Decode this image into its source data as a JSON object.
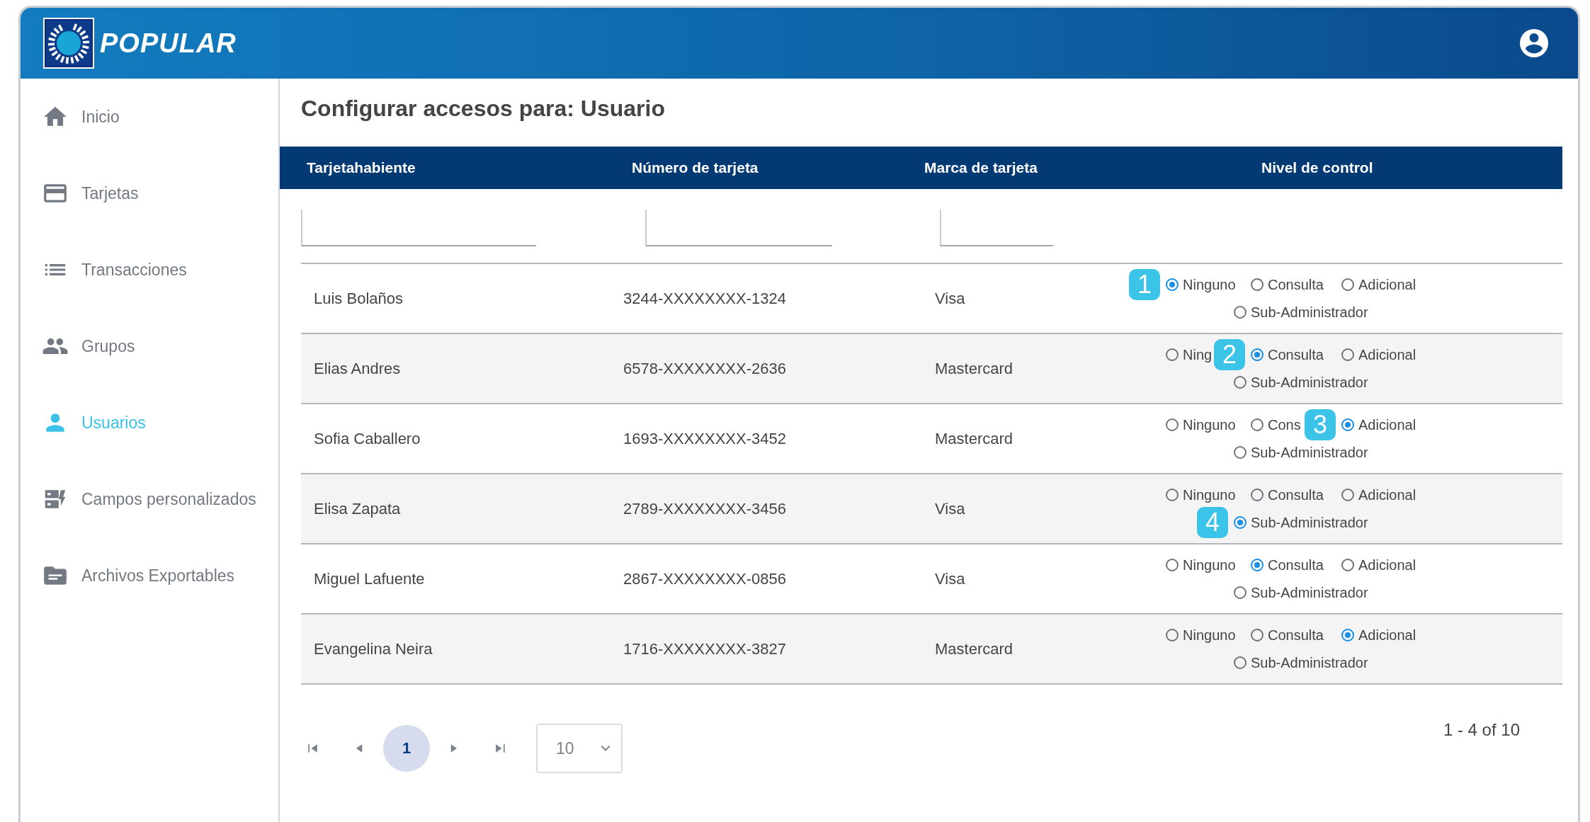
{
  "header": {
    "brand": "POPULAR"
  },
  "sidebar": {
    "items": [
      {
        "label": "Inicio",
        "selected": false
      },
      {
        "label": "Tarjetas",
        "selected": false
      },
      {
        "label": "Transacciones",
        "selected": false
      },
      {
        "label": "Grupos",
        "selected": false
      },
      {
        "label": "Usuarios",
        "selected": true
      },
      {
        "label": "Campos personalizados",
        "selected": false
      },
      {
        "label": "Archivos Exportables",
        "selected": false
      }
    ]
  },
  "page": {
    "title": "Configurar accesos para: Usuario"
  },
  "table": {
    "columns": [
      {
        "label": "Tarjetahabiente",
        "filter": true
      },
      {
        "label": "Número de tarjeta",
        "filter": true
      },
      {
        "label": "Marca de tarjeta",
        "filter": true
      },
      {
        "label": "Nivel de control",
        "filter": false
      }
    ],
    "rows": [
      {
        "cardholder": "Luis Bolaños",
        "card_number": "3244-XXXXXXXX-1324",
        "brand": "Visa",
        "options": [
          {
            "label": "Ninguno",
            "selected": true,
            "badge": "1"
          },
          {
            "label": "Consulta",
            "selected": false
          },
          {
            "label": "Adicional",
            "selected": false
          },
          {
            "label": "Sub-Administrador",
            "selected": false
          }
        ]
      },
      {
        "cardholder": "Elias Andres",
        "card_number": "6578-XXXXXXXX-2636",
        "brand": "Mastercard",
        "options": [
          {
            "label": "Ning",
            "selected": false
          },
          {
            "label": "Consulta",
            "selected": true,
            "badge": "2"
          },
          {
            "label": "Adicional",
            "selected": false
          },
          {
            "label": "Sub-Administrador",
            "selected": false
          }
        ]
      },
      {
        "cardholder": "Sofia Caballero",
        "card_number": "1693-XXXXXXXX-3452",
        "brand": "Mastercard",
        "options": [
          {
            "label": "Ninguno",
            "selected": false
          },
          {
            "label": "Cons",
            "selected": false
          },
          {
            "label": "Adicional",
            "selected": true,
            "badge": "3"
          },
          {
            "label": "Sub-Administrador",
            "selected": false
          }
        ]
      },
      {
        "cardholder": "Elisa Zapata",
        "card_number": "2789-XXXXXXXX-3456",
        "brand": "Visa",
        "options": [
          {
            "label": "Ninguno",
            "selected": false
          },
          {
            "label": "Consulta",
            "selected": false
          },
          {
            "label": "Adicional",
            "selected": false
          },
          {
            "label": "Sub-Administrador",
            "selected": true,
            "badge": "4"
          }
        ]
      },
      {
        "cardholder": "Miguel Lafuente",
        "card_number": "2867-XXXXXXXX-0856",
        "brand": "Visa",
        "options": [
          {
            "label": "Ninguno",
            "selected": false
          },
          {
            "label": "Consulta",
            "selected": true
          },
          {
            "label": "Adicional",
            "selected": false
          },
          {
            "label": "Sub-Administrador",
            "selected": false
          }
        ]
      },
      {
        "cardholder": "Evangelina Neira",
        "card_number": "1716-XXXXXXXX-3827",
        "brand": "Mastercard",
        "options": [
          {
            "label": "Ninguno",
            "selected": false
          },
          {
            "label": "Consulta",
            "selected": false
          },
          {
            "label": "Adicional",
            "selected": true
          },
          {
            "label": "Sub-Administrador",
            "selected": false
          }
        ]
      }
    ]
  },
  "pagination": {
    "pages": [
      {
        "label": "1",
        "selected": true
      }
    ],
    "page_size": "10",
    "range": "1 - 4 of 10"
  }
}
